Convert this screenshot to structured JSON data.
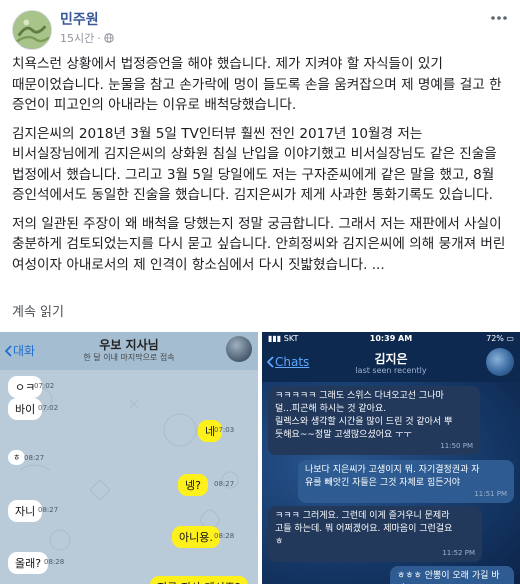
{
  "post": {
    "author": "민주원",
    "time": "15시간",
    "paragraphs": [
      "치욕스런 상황에서 법정증언을 해야 했습니다. 제가 지켜야 할 자식들이 있기 때문이었습니다. 눈물을 참고 손가락에 멍이 들도록 손을 움켜잡으며 제 명예를 걸고 한 증언이 피고인의 아내라는 이유로 배척당했습니다.",
      "김지은씨의 2018년 3월 5일 TV인터뷰 훨씬 전인 2017년 10월경 저는 비서실장님에게 김지은씨의 상화원 침실 난입을 이야기했고 비서실장님도 같은 진술을 법정에서 했습니다. 그리고 3월 5일 당일에도 저는 구자준씨에게 같은 말을 했고, 8월 증인석에서도 동일한 진술을 했습니다. 김지은씨가 제게 사과한 통화기록도 있습니다.",
      "저의 일관된 주장이 왜 배척을 당했는지 정말 궁금합니다. 그래서 저는 재판에서 사실이 충분하게 검토되었는지를 다시 묻고 싶습니다. 안희정씨와 김지은씨에 의해 뭉개져 버린 여성이자 아내로서의 제 인격이 항소심에서 다시 짓밟혔습니다. ..."
    ],
    "see_more": "계속 읽기"
  },
  "left_chat": {
    "back_label": "대화",
    "title": "우보 지사님",
    "subtitle": "한 달 이내 마지막으로 접속",
    "messages": [
      {
        "side": "in",
        "text": "ㅇㅋ",
        "time": "07:02"
      },
      {
        "side": "in",
        "text": "바이",
        "time": "07:02"
      },
      {
        "side": "out",
        "text": "네",
        "time": "07:03"
      },
      {
        "side": "in",
        "text": "ㅎ",
        "time": "08:27"
      },
      {
        "side": "out",
        "text": "넹?",
        "time": "08:27"
      },
      {
        "side": "in",
        "text": "자니",
        "time": "08:27"
      },
      {
        "side": "out",
        "text": "아니용.",
        "time": "08:28"
      },
      {
        "side": "in",
        "text": "올래?",
        "time": "08:28"
      },
      {
        "side": "out",
        "text": "지금 지사 계시죠?",
        "time": ""
      }
    ]
  },
  "right_chat": {
    "carrier": "SKT",
    "clock": "10:39 AM",
    "battery": "72%",
    "back_label": "Chats",
    "name": "김지은",
    "seen": "last seen recently",
    "messages": [
      {
        "side": "in",
        "lines": [
          "ㅋㅋㅋㅋㅋ 그래도 스위스 다녀오고선 그나마",
          "덜...피곤해 하시는 것 같아요.",
          "릴렉스와 생각할 시간을 많이 드린 것 같아서 뿌",
          "듯해요~~정말 고생많으셨어요 ㅜㅜ"
        ],
        "time": "11:50 PM"
      },
      {
        "side": "out",
        "lines": [
          "나보다 지은씨가 고생이지 뭐.  자기결정권과 자",
          "유를 빼앗긴 자들은 그것 자체로 힘든거야"
        ],
        "time": "11:51 PM"
      },
      {
        "side": "in",
        "lines": [
          "ㅋㅋㅋ 그러게요. 그런데 이게 즐거우니 문제라",
          "고들 하는데. 뭐 어쩌겠어요. 제마음이 그런걸요",
          "ㅎ"
        ],
        "time": "11:52 PM"
      },
      {
        "side": "out",
        "lines": [
          "ㅎㅎㅎ 안뽕이 오래 가길 바라~"
        ],
        "time": ""
      }
    ]
  }
}
